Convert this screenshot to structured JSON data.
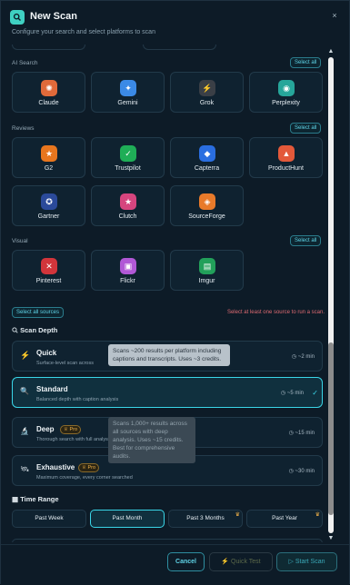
{
  "header": {
    "title": "New Scan",
    "subtitle": "Configure your search and select platforms to scan",
    "close_label": "×"
  },
  "sections": {
    "ai_search": {
      "label": "AI Search",
      "select_all": "Select all",
      "items": [
        {
          "label": "Claude",
          "color": "#e06a3a",
          "glyph": "✺"
        },
        {
          "label": "Gemini",
          "color": "#3b8ae6",
          "glyph": "✦"
        },
        {
          "label": "Grok",
          "color": "#3a3f46",
          "glyph": "⚡"
        },
        {
          "label": "Perplexity",
          "color": "#26a69a",
          "glyph": "◉"
        }
      ]
    },
    "reviews": {
      "label": "Reviews",
      "select_all": "Select all",
      "items": [
        {
          "label": "G2",
          "color": "#e8761e",
          "glyph": "★"
        },
        {
          "label": "Trustpilot",
          "color": "#1fae57",
          "glyph": "✓"
        },
        {
          "label": "Capterra",
          "color": "#2a6ee0",
          "glyph": "◆"
        },
        {
          "label": "ProductHunt",
          "color": "#e3593a",
          "glyph": "▲"
        },
        {
          "label": "Gartner",
          "color": "#2b4a9a",
          "glyph": "✪"
        },
        {
          "label": "Clutch",
          "color": "#d6457e",
          "glyph": "★"
        },
        {
          "label": "SourceForge",
          "color": "#e87a2a",
          "glyph": "◈"
        }
      ]
    },
    "visual": {
      "label": "Visual",
      "select_all": "Select all",
      "items": [
        {
          "label": "Pinterest",
          "color": "#d2353b",
          "glyph": "✕"
        },
        {
          "label": "Flickr",
          "color": "#b158d6",
          "glyph": "▣"
        },
        {
          "label": "Imgur",
          "color": "#22a05a",
          "glyph": "▤"
        }
      ]
    }
  },
  "select_all_sources": "Select all sources",
  "warning": "Select at least one source to run a scan.",
  "scan_depth": {
    "label": "Scan Depth",
    "options": [
      {
        "name": "Quick",
        "desc": "Surface-level scan across",
        "time": "~2 min",
        "icon": "⚡",
        "pro": false,
        "selected": false
      },
      {
        "name": "Standard",
        "desc": "Balanced depth with caption analysis",
        "time": "~5 min",
        "icon": "🔍",
        "pro": false,
        "selected": true
      },
      {
        "name": "Deep",
        "desc": "Thorough search with full analysis",
        "time": "~15 min",
        "icon": "🔬",
        "pro": true,
        "selected": false
      },
      {
        "name": "Exhaustive",
        "desc": "Maximum coverage, every corner searched",
        "time": "~30 min",
        "icon": "🛰",
        "pro": true,
        "selected": false
      }
    ],
    "pro_label": "Pro",
    "tooltip_standard": "Scans ~200 results per platform including captions and transcripts. Uses ~3 credits.",
    "tooltip_deep": "Scans 1,000+ results across all sources with deep analysis. Uses ~15 credits. Best for comprehensive audits."
  },
  "time_range": {
    "label": "Time Range",
    "options": [
      {
        "label": "Past Week",
        "selected": false,
        "pro": false
      },
      {
        "label": "Past Month",
        "selected": true,
        "pro": false
      },
      {
        "label": "Past 3 Months",
        "selected": false,
        "pro": true
      },
      {
        "label": "Past Year",
        "selected": false,
        "pro": true
      }
    ]
  },
  "footer": {
    "cancel": "Cancel",
    "quick_test": "Quick Test",
    "start_scan": "Start Scan"
  },
  "colors": {
    "accent": "#3ad6e8",
    "warning": "#e06b72",
    "pro": "#f3b44a"
  }
}
